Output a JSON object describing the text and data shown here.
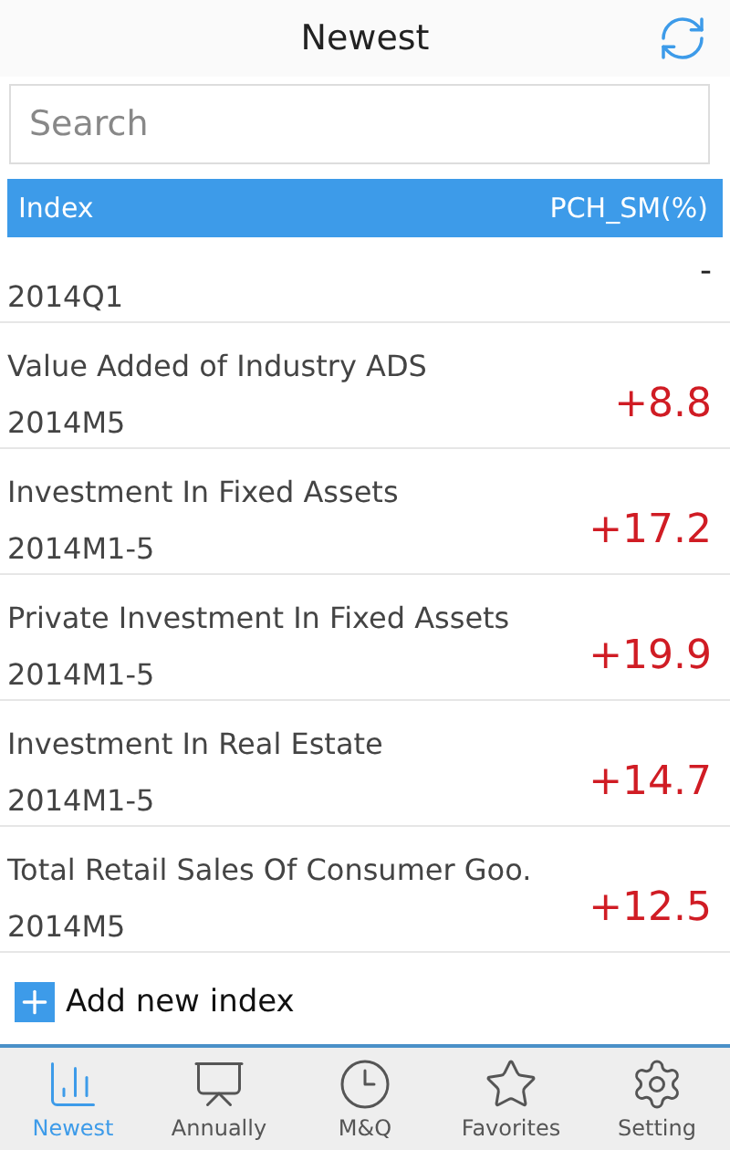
{
  "header": {
    "title": "Newest"
  },
  "search": {
    "placeholder": "Search"
  },
  "table": {
    "columns": [
      "Index",
      "PCH_SM(%)"
    ],
    "rows": [
      {
        "kind": "empty",
        "period": "2014Q1",
        "value": "-"
      },
      {
        "kind": "change",
        "name": "Value Added of Industry ADS",
        "period": "2014M5",
        "value": "+8.8"
      },
      {
        "kind": "change",
        "name": "Investment In Fixed Assets",
        "period": "2014M1-5",
        "value": "+17.2"
      },
      {
        "kind": "change",
        "name": "Private Investment In Fixed Assets",
        "period": "2014M1-5",
        "value": "+19.9"
      },
      {
        "kind": "change",
        "name": "Investment In Real Estate",
        "period": "2014M1-5",
        "value": "+14.7"
      },
      {
        "kind": "change",
        "name": "Total Retail Sales Of Consumer Goo.",
        "period": "2014M5",
        "value": "+12.5"
      }
    ]
  },
  "add_button": {
    "label": "Add new index"
  },
  "tab_bar": [
    {
      "kind": "newest",
      "label": "Newest",
      "selected": true
    },
    {
      "kind": "annually",
      "label": "Annually",
      "selected": false
    },
    {
      "kind": "mq",
      "label": "M&Q",
      "selected": false
    },
    {
      "kind": "favorites",
      "label": "Favorites",
      "selected": false
    },
    {
      "kind": "setting",
      "label": "Setting",
      "selected": false
    }
  ]
}
